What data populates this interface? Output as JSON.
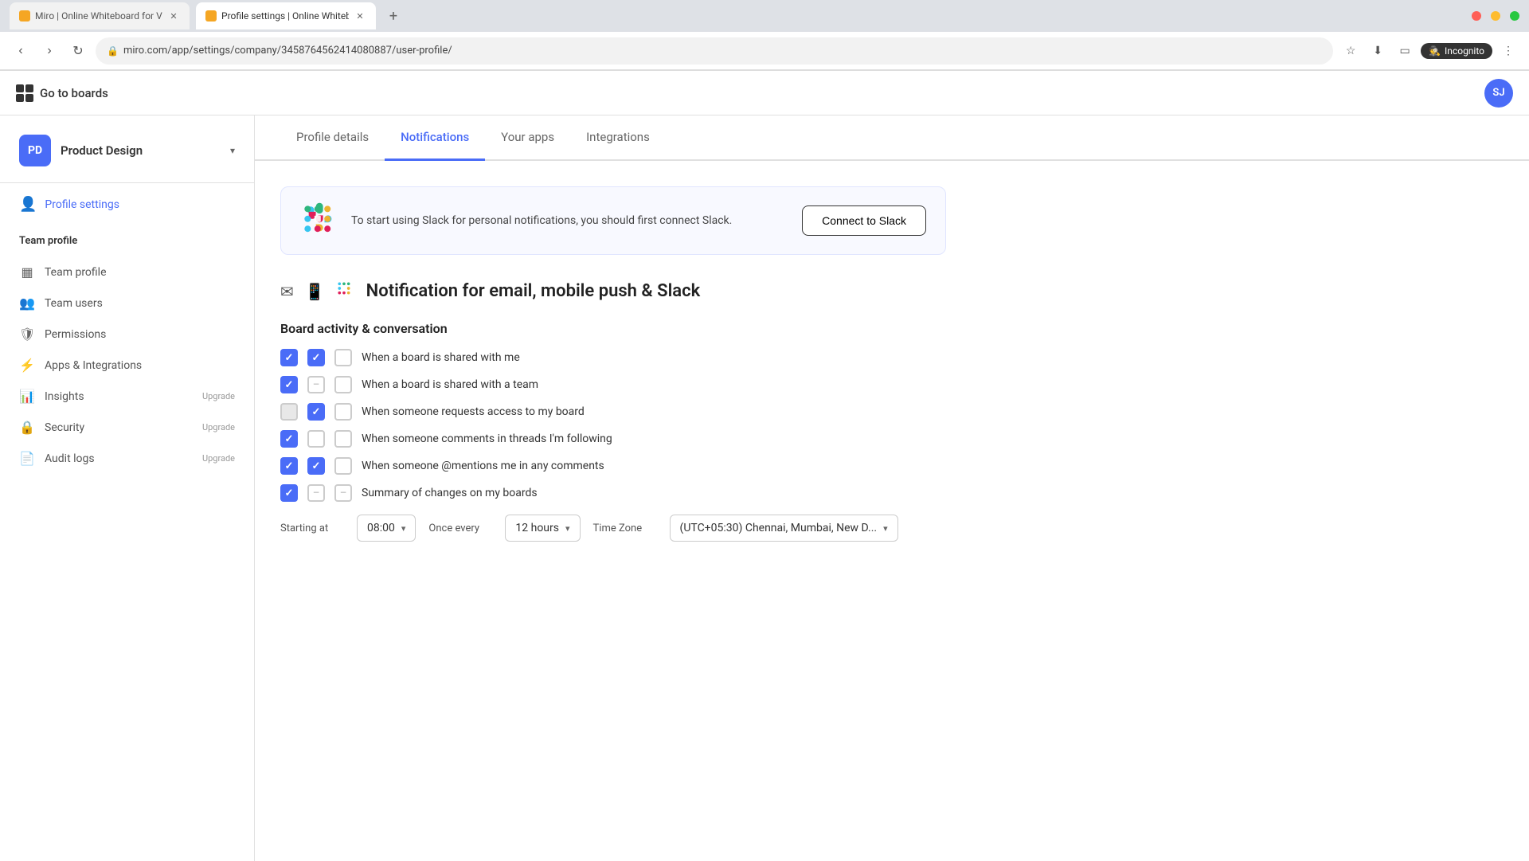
{
  "browser": {
    "tabs": [
      {
        "label": "Miro | Online Whiteboard for Vis...",
        "active": false,
        "icon": "miro"
      },
      {
        "label": "Profile settings | Online Whitebo...",
        "active": true,
        "icon": "miro"
      }
    ],
    "url": "miro.com/app/settings/company/3458764562414080887/user-profile/",
    "incognito_label": "Incognito"
  },
  "header": {
    "go_to_boards": "Go to boards",
    "avatar_initials": "SJ"
  },
  "sidebar": {
    "org_initials": "PD",
    "org_name": "Product Design",
    "profile_settings_label": "Profile settings",
    "team_profile_section": "Team profile",
    "nav_items": [
      {
        "id": "team-profile",
        "label": "Team profile",
        "icon": "grid",
        "badge": ""
      },
      {
        "id": "team-users",
        "label": "Team users",
        "icon": "person",
        "badge": ""
      },
      {
        "id": "permissions",
        "label": "Permissions",
        "icon": "shield",
        "badge": ""
      },
      {
        "id": "apps-integrations",
        "label": "Apps & Integrations",
        "icon": "lightning",
        "badge": ""
      },
      {
        "id": "insights",
        "label": "Insights",
        "icon": "bar-chart",
        "badge": "Upgrade"
      },
      {
        "id": "security",
        "label": "Security",
        "icon": "lock",
        "badge": "Upgrade"
      },
      {
        "id": "audit-logs",
        "label": "Audit logs",
        "icon": "doc",
        "badge": "Upgrade"
      }
    ]
  },
  "content": {
    "tabs": [
      {
        "id": "profile-details",
        "label": "Profile details",
        "active": false
      },
      {
        "id": "notifications",
        "label": "Notifications",
        "active": true
      },
      {
        "id": "your-apps",
        "label": "Your apps",
        "active": false
      },
      {
        "id": "integrations",
        "label": "Integrations",
        "active": false
      }
    ],
    "slack_banner": {
      "text": "To start using Slack for personal notifications, you should first connect Slack.",
      "connect_btn": "Connect to Slack"
    },
    "notification_section": {
      "title": "Notification for email, mobile push & Slack",
      "board_activity_title": "Board activity & conversation",
      "rows": [
        {
          "email": true,
          "mobile": true,
          "slack": false,
          "label": "When a board is shared with me"
        },
        {
          "email": true,
          "mobile": "dash",
          "slack": false,
          "label": "When a board is shared with a team"
        },
        {
          "email": "disabled",
          "mobile": true,
          "slack": false,
          "label": "When someone requests access to my board"
        },
        {
          "email": true,
          "mobile": false,
          "slack": false,
          "label": "When someone comments in threads I'm following"
        },
        {
          "email": true,
          "mobile": true,
          "slack": false,
          "label": "When someone @mentions me in any comments"
        },
        {
          "email": true,
          "mobile": "dash",
          "slack": "dash",
          "label": "Summary of changes on my boards"
        }
      ],
      "starting_at_label": "Starting at",
      "once_every_label": "Once every",
      "time_zone_label": "Time Zone",
      "starting_at_value": "08:00",
      "once_every_value": "12 hours",
      "time_zone_value": "(UTC+05:30) Chennai, Mumbai, New D..."
    }
  }
}
